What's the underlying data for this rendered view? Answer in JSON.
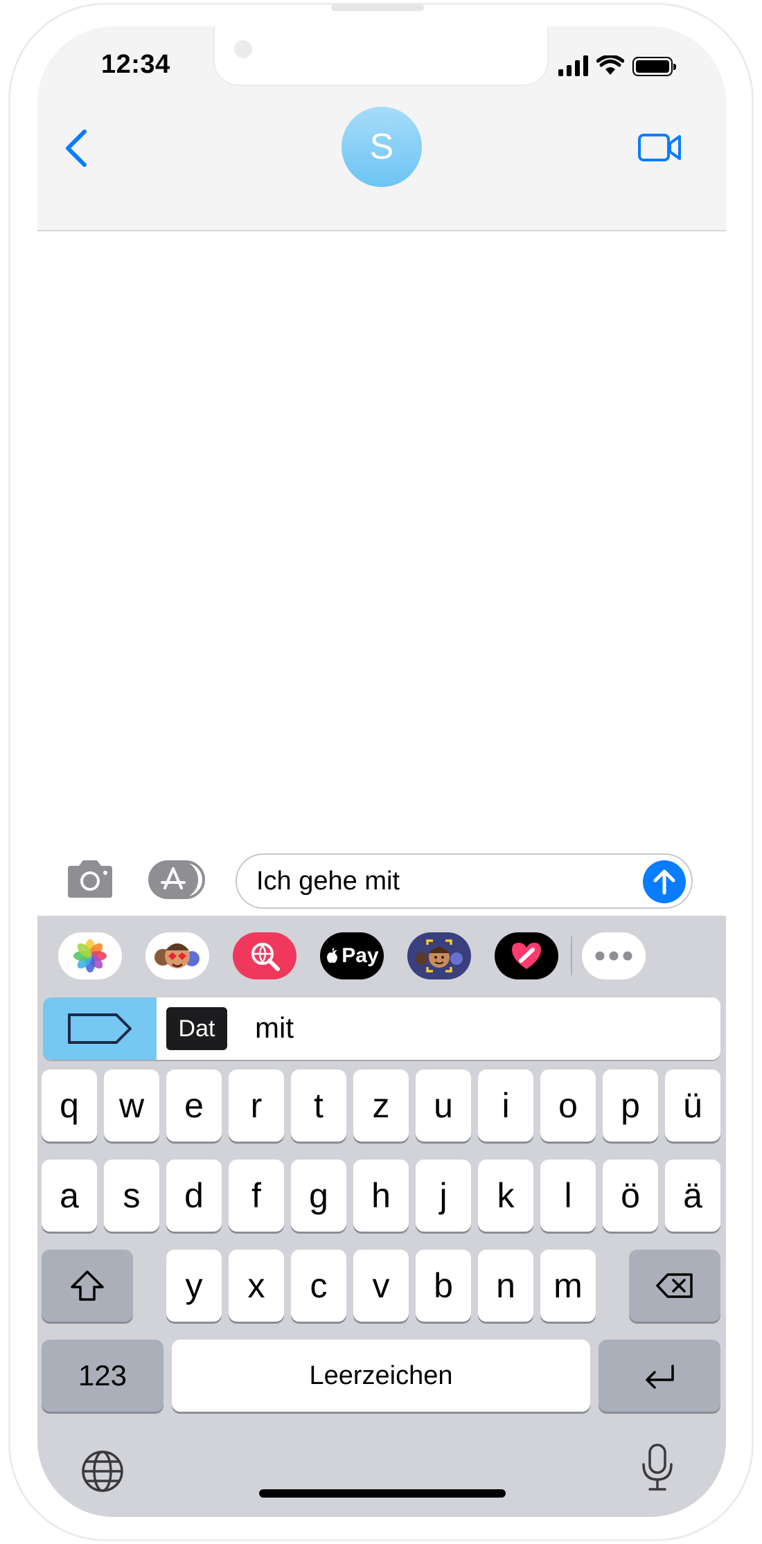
{
  "status_bar": {
    "time": "12:34",
    "icons": [
      "cellular-signal-icon",
      "wifi-icon",
      "battery-icon"
    ]
  },
  "header": {
    "back_icon": "chevron-left-icon",
    "contact_initial": "S",
    "video_icon": "video-camera-icon"
  },
  "compose": {
    "camera_icon": "camera-icon",
    "apps_icon": "app-store-icon",
    "message_text": "Ich gehe mit",
    "send_icon": "arrow-up-icon"
  },
  "app_drawer": {
    "apps": [
      "photos-icon",
      "memoji-stickers-icon",
      "images-search-icon",
      "apple-pay-icon",
      "memoji-icon",
      "digital-touch-icon",
      "more-icon"
    ],
    "applepay_label": "Pay"
  },
  "suggestion": {
    "tag_icon": "tag-icon",
    "badge": "Dat",
    "word": "mit"
  },
  "keyboard": {
    "row1": [
      "q",
      "w",
      "e",
      "r",
      "t",
      "z",
      "u",
      "i",
      "o",
      "p",
      "ü"
    ],
    "row2": [
      "a",
      "s",
      "d",
      "f",
      "g",
      "h",
      "j",
      "k",
      "l",
      "ö",
      "ä"
    ],
    "row3": [
      "y",
      "x",
      "c",
      "v",
      "b",
      "n",
      "m"
    ],
    "numbers_label": "123",
    "space_label": "Leerzeichen",
    "shift_icon": "shift-icon",
    "delete_icon": "delete-icon",
    "return_icon": "return-icon",
    "globe_icon": "globe-icon",
    "mic_icon": "microphone-icon"
  },
  "colors": {
    "accent": "#0a7cff",
    "header_bg": "#f4f4f5",
    "keyboard_bg": "#d1d3d9",
    "special_key": "#abafb9",
    "avatar": "#7ecbf5"
  }
}
